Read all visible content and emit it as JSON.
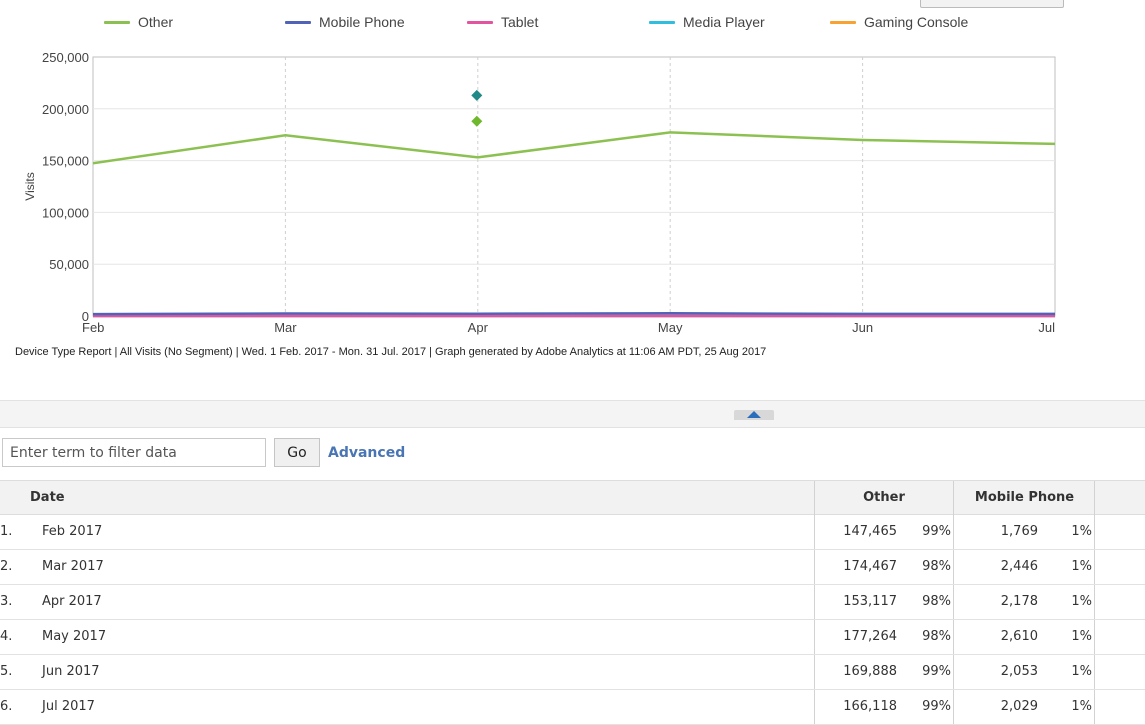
{
  "legend": [
    {
      "label": "Other",
      "color": "#8cc152"
    },
    {
      "label": "Mobile Phone",
      "color": "#5063b8"
    },
    {
      "label": "Tablet",
      "color": "#e4539f"
    },
    {
      "label": "Media Player",
      "color": "#2fbde0"
    },
    {
      "label": "Gaming Console",
      "color": "#f7a233"
    }
  ],
  "chart_data": {
    "type": "line",
    "x": [
      "Feb",
      "Mar",
      "Apr",
      "May",
      "Jun",
      "Jul"
    ],
    "ylabel": "Visits",
    "ylim": [
      0,
      250000
    ],
    "yticks": [
      "0",
      "50,000",
      "100,000",
      "150,000",
      "200,000",
      "250,000"
    ],
    "grid": true,
    "legend_position": "top",
    "series": [
      {
        "name": "Other",
        "color": "#8cc152",
        "values": [
          147465,
          174467,
          153117,
          177264,
          169888,
          166118
        ]
      },
      {
        "name": "Mobile Phone",
        "color": "#5063b8",
        "values": [
          1769,
          2446,
          2178,
          2610,
          2053,
          2029
        ]
      },
      {
        "name": "Tablet",
        "color": "#e4539f",
        "values": [
          0,
          0,
          0,
          0,
          0,
          0
        ]
      },
      {
        "name": "Media Player",
        "color": "#2fbde0",
        "values": [
          0,
          0,
          0,
          0,
          0,
          0
        ]
      },
      {
        "name": "Gaming Console",
        "color": "#f7a233",
        "values": [
          0,
          0,
          0,
          0,
          0,
          0
        ]
      }
    ],
    "markers": [
      {
        "x": "Apr",
        "y": 213000,
        "color": "#1f8a86"
      },
      {
        "x": "Apr",
        "y": 188000,
        "color": "#6fb72d"
      }
    ]
  },
  "footer_note": "Device Type Report | All Visits (No Segment) | Wed.  1 Feb. 2017 - Mon. 31 Jul. 2017 | Graph generated by Adobe Analytics at 11:06 AM PDT, 25 Aug 2017",
  "filter": {
    "placeholder": "Enter term to filter data",
    "go_label": "Go",
    "advanced_label": "Advanced"
  },
  "table": {
    "headers": {
      "date": "Date",
      "other": "Other",
      "mobile": "Mobile Phone"
    },
    "rows": [
      {
        "index": "1.",
        "date": "Feb 2017",
        "other": "147,465",
        "other_pct": "99%",
        "mobile": "1,769",
        "mobile_pct": "1%"
      },
      {
        "index": "2.",
        "date": "Mar 2017",
        "other": "174,467",
        "other_pct": "98%",
        "mobile": "2,446",
        "mobile_pct": "1%"
      },
      {
        "index": "3.",
        "date": "Apr 2017",
        "other": "153,117",
        "other_pct": "98%",
        "mobile": "2,178",
        "mobile_pct": "1%"
      },
      {
        "index": "4.",
        "date": "May 2017",
        "other": "177,264",
        "other_pct": "98%",
        "mobile": "2,610",
        "mobile_pct": "1%"
      },
      {
        "index": "5.",
        "date": "Jun 2017",
        "other": "169,888",
        "other_pct": "99%",
        "mobile": "2,053",
        "mobile_pct": "1%"
      },
      {
        "index": "6.",
        "date": "Jul 2017",
        "other": "166,118",
        "other_pct": "99%",
        "mobile": "2,029",
        "mobile_pct": "1%"
      }
    ]
  }
}
